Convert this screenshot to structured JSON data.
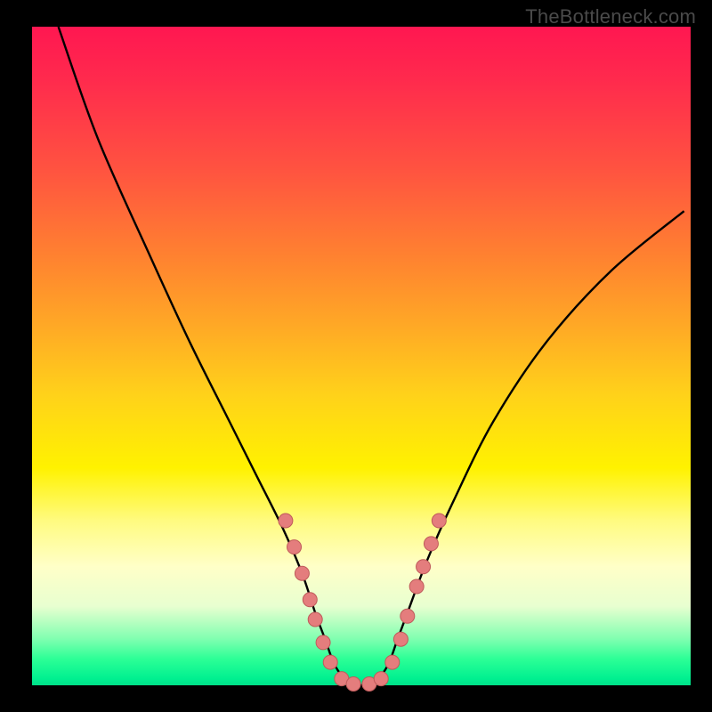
{
  "watermark": "TheBottleneck.com",
  "chart_data": {
    "type": "line",
    "title": "",
    "xlabel": "",
    "ylabel": "",
    "xlim": [
      0,
      100
    ],
    "ylim": [
      0,
      100
    ],
    "series": [
      {
        "name": "curve",
        "x": [
          4,
          10,
          18,
          24,
          30,
          34,
          38,
          41,
          43,
          44.5,
          46,
          48,
          50,
          52,
          54,
          55.5,
          57,
          60,
          64,
          70,
          78,
          88,
          99
        ],
        "y": [
          100,
          83,
          65,
          52,
          40,
          32,
          24,
          17,
          11,
          7,
          3,
          0.5,
          0,
          0.5,
          3,
          7,
          11,
          19,
          28,
          40,
          52,
          63,
          72
        ]
      }
    ],
    "markers": [
      {
        "x": 38.5,
        "y": 25
      },
      {
        "x": 39.8,
        "y": 21
      },
      {
        "x": 41.0,
        "y": 17
      },
      {
        "x": 42.2,
        "y": 13
      },
      {
        "x": 43.0,
        "y": 10
      },
      {
        "x": 44.2,
        "y": 6.5
      },
      {
        "x": 45.3,
        "y": 3.5
      },
      {
        "x": 47.0,
        "y": 1.0
      },
      {
        "x": 48.8,
        "y": 0.2
      },
      {
        "x": 51.2,
        "y": 0.2
      },
      {
        "x": 53.0,
        "y": 1.0
      },
      {
        "x": 54.7,
        "y": 3.5
      },
      {
        "x": 56.0,
        "y": 7.0
      },
      {
        "x": 57.0,
        "y": 10.5
      },
      {
        "x": 58.4,
        "y": 15
      },
      {
        "x": 59.4,
        "y": 18
      },
      {
        "x": 60.6,
        "y": 21.5
      },
      {
        "x": 61.8,
        "y": 25
      }
    ],
    "marker_style": {
      "fill": "#e47d7d",
      "stroke": "#bf5a5a",
      "r": 8
    }
  }
}
